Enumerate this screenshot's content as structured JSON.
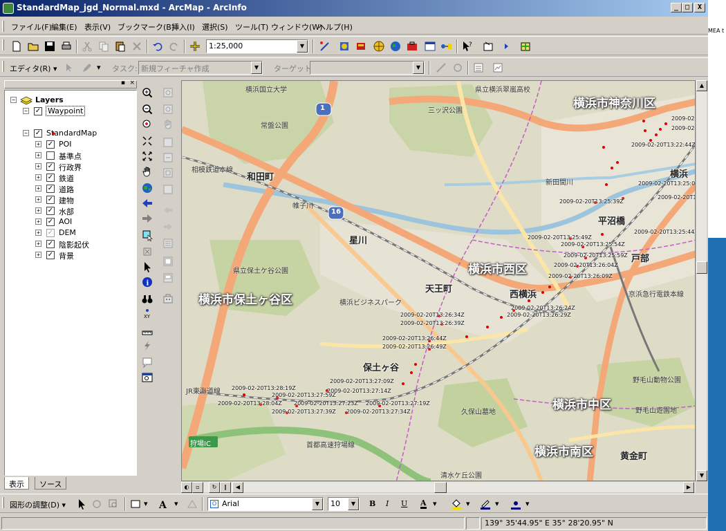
{
  "window": {
    "title": "StandardMap_jgd_Normal.mxd - ArcMap - ArcInfo",
    "min_label": "_",
    "max_label": "□",
    "close_label": "X"
  },
  "menu": [
    "ファイル(F)",
    "編集(E)",
    "表示(V)",
    "ブックマーク(B)",
    "挿入(I)",
    "選択(S)",
    "ツール(T)",
    "ウィンドウ(W)",
    "ヘルプ(H)"
  ],
  "standard_toolbar": {
    "scale_value": "1:25,000"
  },
  "editor_toolbar": {
    "editor_label": "エディタ(R) ▾",
    "task_label": "タスク:",
    "task_value": "新規フィーチャ作成",
    "target_label": "ターゲット:",
    "target_value": ""
  },
  "toc": {
    "root_label": "Layers",
    "layers": [
      {
        "name": "Waypoint",
        "checked": true,
        "expand": "−",
        "indent": 0
      },
      {
        "name": "StandardMap",
        "checked": true,
        "expand": "−",
        "indent": 0
      },
      {
        "name": "POI",
        "checked": true,
        "expand": "+",
        "indent": 1
      },
      {
        "name": "基準点",
        "checked": false,
        "expand": "+",
        "indent": 1
      },
      {
        "name": "行政界",
        "checked": true,
        "expand": "+",
        "indent": 1
      },
      {
        "name": "鉄道",
        "checked": true,
        "expand": "+",
        "indent": 1
      },
      {
        "name": "道路",
        "checked": true,
        "expand": "+",
        "indent": 1
      },
      {
        "name": "建物",
        "checked": true,
        "expand": "+",
        "indent": 1
      },
      {
        "name": "水部",
        "checked": true,
        "expand": "+",
        "indent": 1
      },
      {
        "name": "AOI",
        "checked": true,
        "expand": "+",
        "indent": 1
      },
      {
        "name": "DEM",
        "checked": true,
        "expand": "+",
        "indent": 1,
        "grey": true
      },
      {
        "name": "陰影起伏",
        "checked": true,
        "expand": "+",
        "indent": 1
      },
      {
        "name": "背景",
        "checked": true,
        "expand": "+",
        "indent": 1
      }
    ],
    "tabs": [
      "表示",
      "ソース"
    ]
  },
  "map": {
    "area_labels": [
      "横浜市神奈川区",
      "横浜市西区",
      "横浜市保土ヶ谷区",
      "横浜市中区",
      "横浜市南区"
    ],
    "place_labels": [
      "和田町",
      "星川",
      "天王町",
      "西横浜",
      "平沼橋",
      "戸部",
      "保土ヶ谷",
      "黄金町",
      "横浜"
    ],
    "small_labels": [
      "横浜国立大学",
      "県立横浜翠嵐高校",
      "三ッ沢公園",
      "常盤公園",
      "県立保土ケ谷公園",
      "横浜ビジネスパーク",
      "久保山墓地",
      "野毛山動物公園",
      "野毛山遊園地",
      "清水ケ丘公園",
      "JR東海道線",
      "相模鉄道本線",
      "新田間川",
      "帷子川",
      "京浜急行電鉄本線",
      "首都高速狩場線",
      "狩場IC"
    ],
    "route_shields": [
      "1",
      "16"
    ],
    "waypoints": [
      "2009-02-20T13:22:29Z",
      "2009-02-20T13:22:34Z",
      "2009-02-20T13:22:44Z",
      "2009-02-20T13:25:09Z",
      "2009-02-20T13:25:19Z",
      "2009-02-20T13:25:39Z",
      "2009-02-20T13:25:44Z",
      "2009-02-20T13:25:49Z",
      "2009-02-20T13:25:54Z",
      "2009-02-20T13:25:59Z",
      "2009-02-20T13:26:04Z",
      "2009-02-20T13:26:09Z",
      "2009-02-20T13:26:24Z",
      "2009-02-20T13:26:29Z",
      "2009-02-20T13:26:34Z",
      "2009-02-20T13:26:39Z",
      "2009-02-20T13:26:44Z",
      "2009-02-20T13:26:49Z",
      "2009-02-20T13:27:09Z",
      "2009-02-20T13:28:19Z",
      "2009-02-20T13:27:59Z",
      "2009-02-20T13:27:14Z",
      "2009-02-20T13:28:04Z",
      "2009-02-20T13:27:23Z",
      "2009-02-20T13:27:19Z",
      "2009-02-20T13:27:39Z",
      "2009-02-20T13:27:34Z"
    ]
  },
  "draw_toolbar": {
    "drawing_label": "図形の調整(D) ▾",
    "font_name": "Arial",
    "font_size": "10",
    "bold_label": "B",
    "italic_label": "I",
    "underline_label": "U",
    "font_color_label": "A"
  },
  "status": {
    "coordinates": "139° 35'44.95\" E  35° 28'20.95\" N"
  },
  "background_fragment": "MEA t"
}
